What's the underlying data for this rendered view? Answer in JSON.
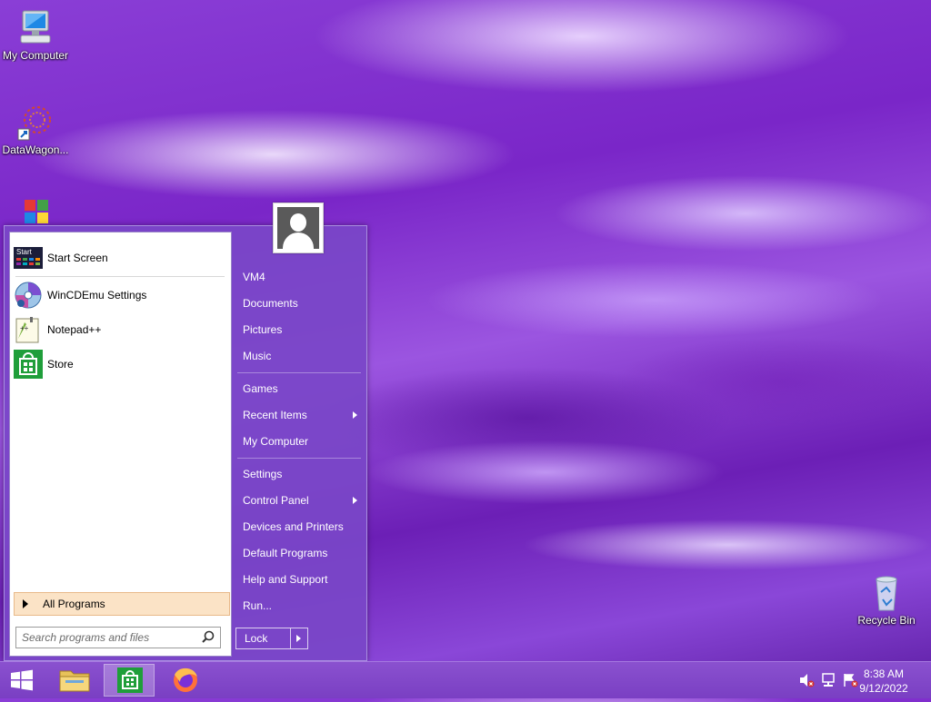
{
  "desktop": {
    "icons": [
      {
        "label": "My Computer"
      },
      {
        "label": "DataWagon..."
      },
      {
        "label": "Recycle Bin"
      }
    ]
  },
  "start_menu": {
    "pinned": [
      {
        "label": "Start Screen",
        "icon": "start-screen-icon"
      },
      {
        "label": "WinCDEmu Settings",
        "icon": "wincdemu-icon"
      },
      {
        "label": "Notepad++",
        "icon": "notepadpp-icon"
      },
      {
        "label": "Store",
        "icon": "store-icon"
      }
    ],
    "start_icon_text": "Start",
    "all_programs": "All Programs",
    "search_placeholder": "Search programs and files",
    "right_items": [
      {
        "label": "VM4"
      },
      {
        "label": "Documents"
      },
      {
        "label": "Pictures"
      },
      {
        "label": "Music"
      },
      {
        "label": "Games"
      },
      {
        "label": "Recent Items",
        "submenu": true
      },
      {
        "label": "My Computer"
      },
      {
        "label": "Settings"
      },
      {
        "label": "Control Panel",
        "submenu": true
      },
      {
        "label": "Devices and Printers"
      },
      {
        "label": "Default Programs"
      },
      {
        "label": "Help and Support"
      },
      {
        "label": "Run..."
      }
    ],
    "lock_label": "Lock"
  },
  "taskbar": {
    "buttons": [
      "start-button",
      "file-explorer",
      "store",
      "firefox"
    ],
    "active": "store"
  },
  "tray": {
    "time": "8:38 AM",
    "date": "9/12/2022"
  },
  "colors": {
    "accent": "#7a3fc3",
    "start_menu_bg": "#7a46c8",
    "all_programs_bg": "#fbe3c6"
  }
}
